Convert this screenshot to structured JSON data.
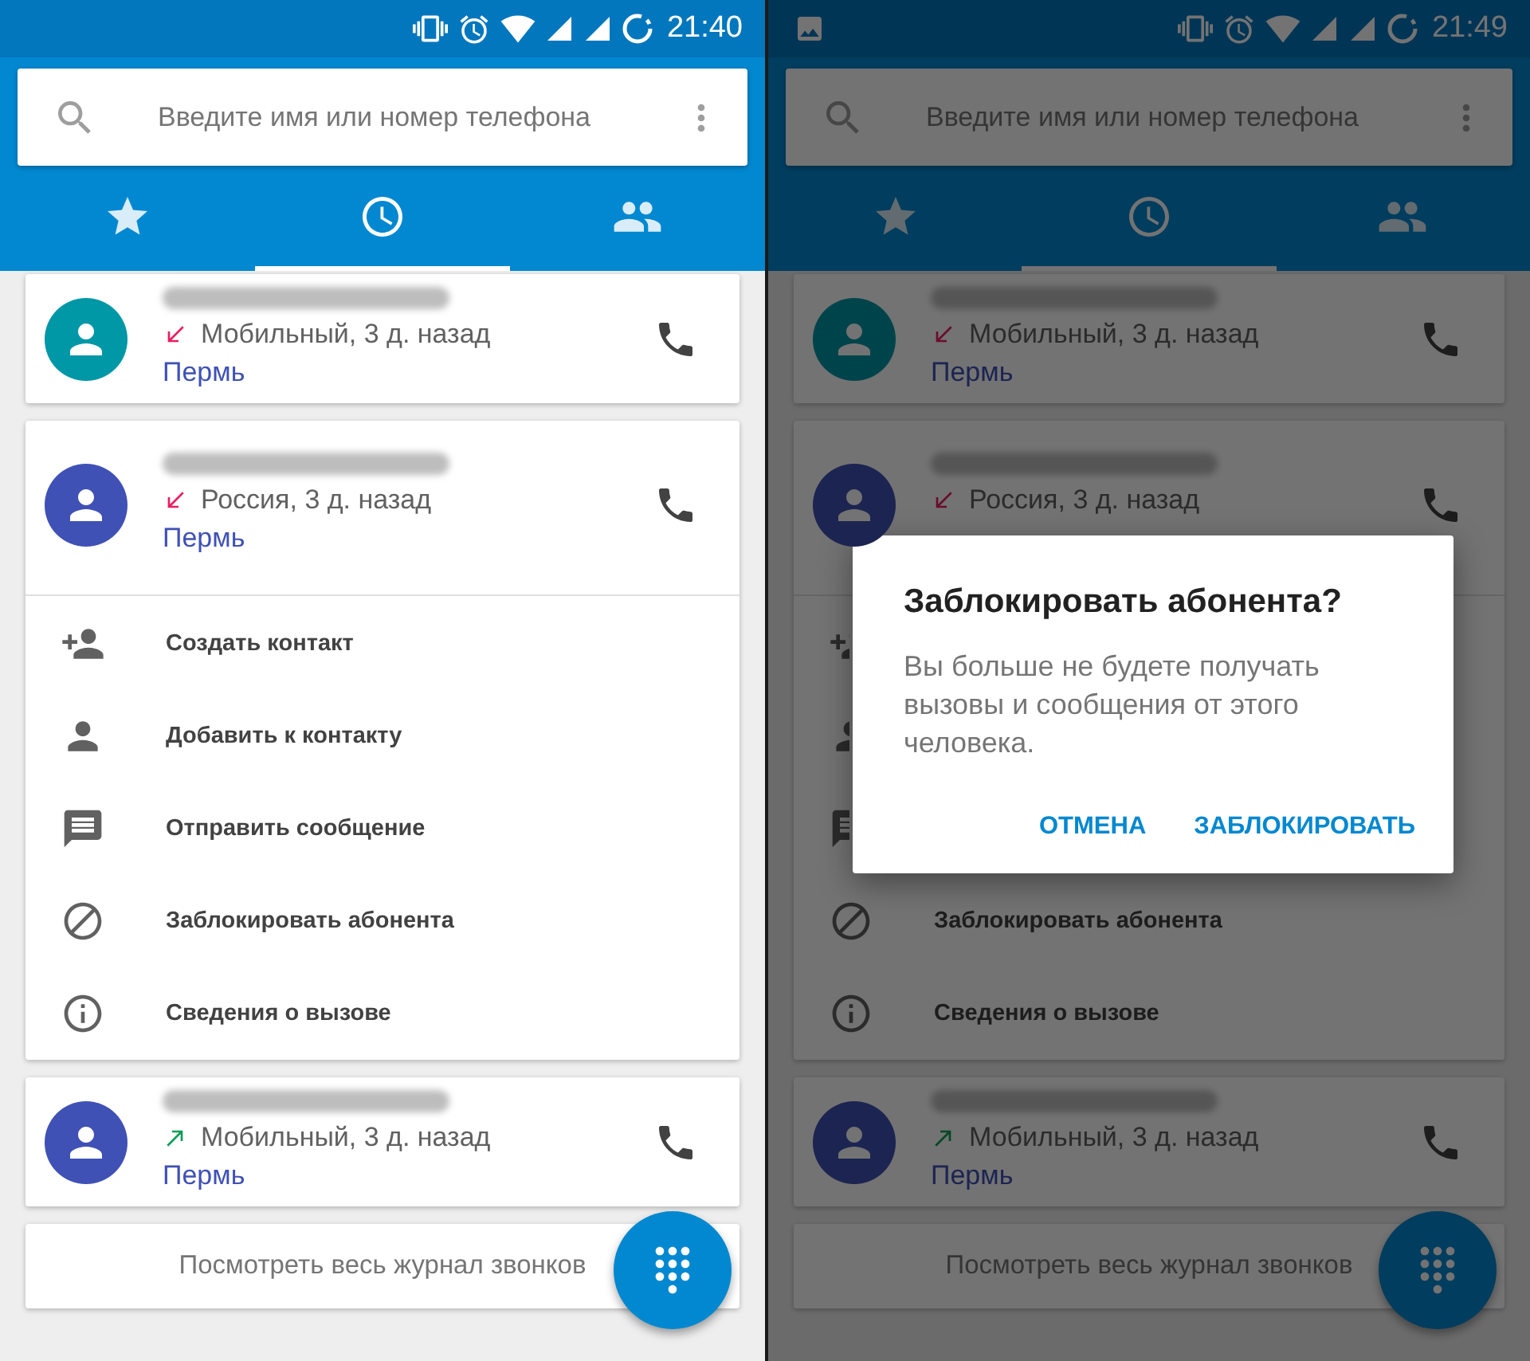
{
  "phones": [
    {
      "status_bar": {
        "time": "21:40",
        "image_icon": false
      },
      "search": {
        "placeholder": "Введите имя или номер телефона"
      },
      "tabs": [
        {
          "kind": "favorites",
          "selected": false
        },
        {
          "kind": "recent",
          "selected": true
        },
        {
          "kind": "contacts",
          "selected": false
        }
      ],
      "calls": [
        {
          "kind": "incoming",
          "color": "#0097a7",
          "name_redacted": true,
          "detail": "Мобильный, 3 д. назад",
          "location": "Пермь",
          "expanded": false
        },
        {
          "kind": "incoming",
          "color": "#3f51b5",
          "name_redacted": true,
          "detail": "Россия, 3 д. назад",
          "location": "Пермь",
          "expanded": true,
          "actions": [
            {
              "kind": "create-contact",
              "label": "Создать контакт"
            },
            {
              "kind": "add-to-contact",
              "label": "Добавить к контакту"
            },
            {
              "kind": "message",
              "label": "Отправить сообщение"
            },
            {
              "kind": "block",
              "label": "Заблокировать абонента"
            },
            {
              "kind": "details",
              "label": "Сведения о вызове"
            }
          ]
        },
        {
          "kind": "outgoing",
          "color": "#3f51b5",
          "name_redacted": true,
          "detail": "Мобильный, 3 д. назад",
          "location": "Пермь",
          "expanded": false
        }
      ],
      "footer_link": "Посмотреть весь журнал звонков"
    },
    {
      "status_bar": {
        "time": "21:49",
        "image_icon": true
      },
      "search": {
        "placeholder": "Введите имя или номер телефона"
      },
      "tabs": [
        {
          "kind": "favorites",
          "selected": false
        },
        {
          "kind": "recent",
          "selected": true
        },
        {
          "kind": "contacts",
          "selected": false
        }
      ],
      "calls": [
        {
          "kind": "incoming",
          "color": "#00444b",
          "name_redacted": true,
          "detail": "Мобильный, 3 д. назад",
          "location": "Пермь",
          "expanded": false
        },
        {
          "kind": "incoming",
          "color": "#1c2451",
          "name_redacted": true,
          "detail": "Россия, 3 д. назад",
          "expanded": true,
          "actions": [
            {
              "kind": "create-contact"
            },
            {
              "kind": "add-to-contact"
            },
            {
              "kind": "message"
            },
            {
              "kind": "block",
              "label": "Заблокировать абонента"
            },
            {
              "kind": "details",
              "label": "Сведения о вызове"
            }
          ]
        },
        {
          "kind": "outgoing",
          "color": "#1c2451",
          "name_redacted": true,
          "detail": "Мобильный, 3 д. назад",
          "location": "Пермь",
          "expanded": false
        }
      ],
      "footer_link": "Посмотреть весь журнал звонков",
      "dialog": {
        "title": "Заблокировать абонента?",
        "message": "Вы больше не будете получать вызовы и сообщения от этого человека.",
        "buttons": [
          "ОТМЕНА",
          "ЗАБЛОКИРОВАТЬ"
        ]
      }
    }
  ]
}
